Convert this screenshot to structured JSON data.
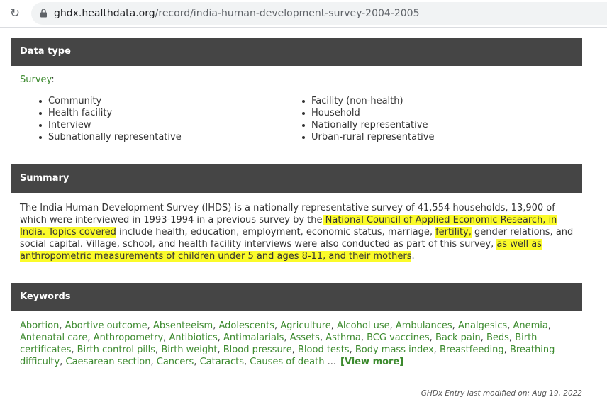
{
  "browser": {
    "url_host": "ghdx.healthdata.org",
    "url_path": "/record/india-human-development-survey-2004-2005"
  },
  "data_type": {
    "header": "Data type",
    "survey_label": "Survey",
    "survey_colon": ":",
    "left_items": [
      "Community",
      "Health facility",
      "Interview",
      "Subnationally representative"
    ],
    "right_items": [
      "Facility (non-health)",
      "Household",
      "Nationally representative",
      "Urban-rural representative"
    ]
  },
  "summary": {
    "header": "Summary",
    "p1": "The India Human Development Survey (IHDS) is a nationally representative survey of 41,554 households, 13,900 of which were interviewed in 1993-1994 in a previous survey by the",
    "h1": " National Council of Applied Economic Research, in India. Topics covered",
    "p2": " include health, education, employment, economic status, marriage, ",
    "h2": "fertility,",
    "p3": " gender relations, and social capital. Village, school, and health facility interviews were also conducted as part of this survey, ",
    "h3": "as well as anthropometric measurements of children under 5 and ages 8-11, and their mothers",
    "p4": "."
  },
  "keywords": {
    "header": "Keywords",
    "items": [
      "Abortion",
      "Abortive outcome",
      "Absenteeism",
      "Adolescents",
      "Agriculture",
      "Alcohol use",
      "Ambulances",
      "Analgesics",
      "Anemia",
      "Antenatal care",
      "Anthropometry",
      "Antibiotics",
      "Antimalarials",
      "Assets",
      "Asthma",
      "BCG vaccines",
      "Back pain",
      "Beds",
      "Birth certificates",
      "Birth control pills",
      "Birth weight",
      "Blood pressure",
      "Blood tests",
      "Body mass index",
      "Breastfeeding",
      "Breathing difficulty",
      "Caesarean section",
      "Cancers",
      "Cataracts",
      "Causes of death"
    ],
    "separator": ", ",
    "ellipsis": " ...",
    "view_more": "[View more]"
  },
  "footer": {
    "modified": "GHDx Entry last modified on: Aug 19, 2022"
  },
  "colors": {
    "header_bg": "#454545",
    "link": "#3c8a2e",
    "highlight": "#fbfb2a"
  }
}
